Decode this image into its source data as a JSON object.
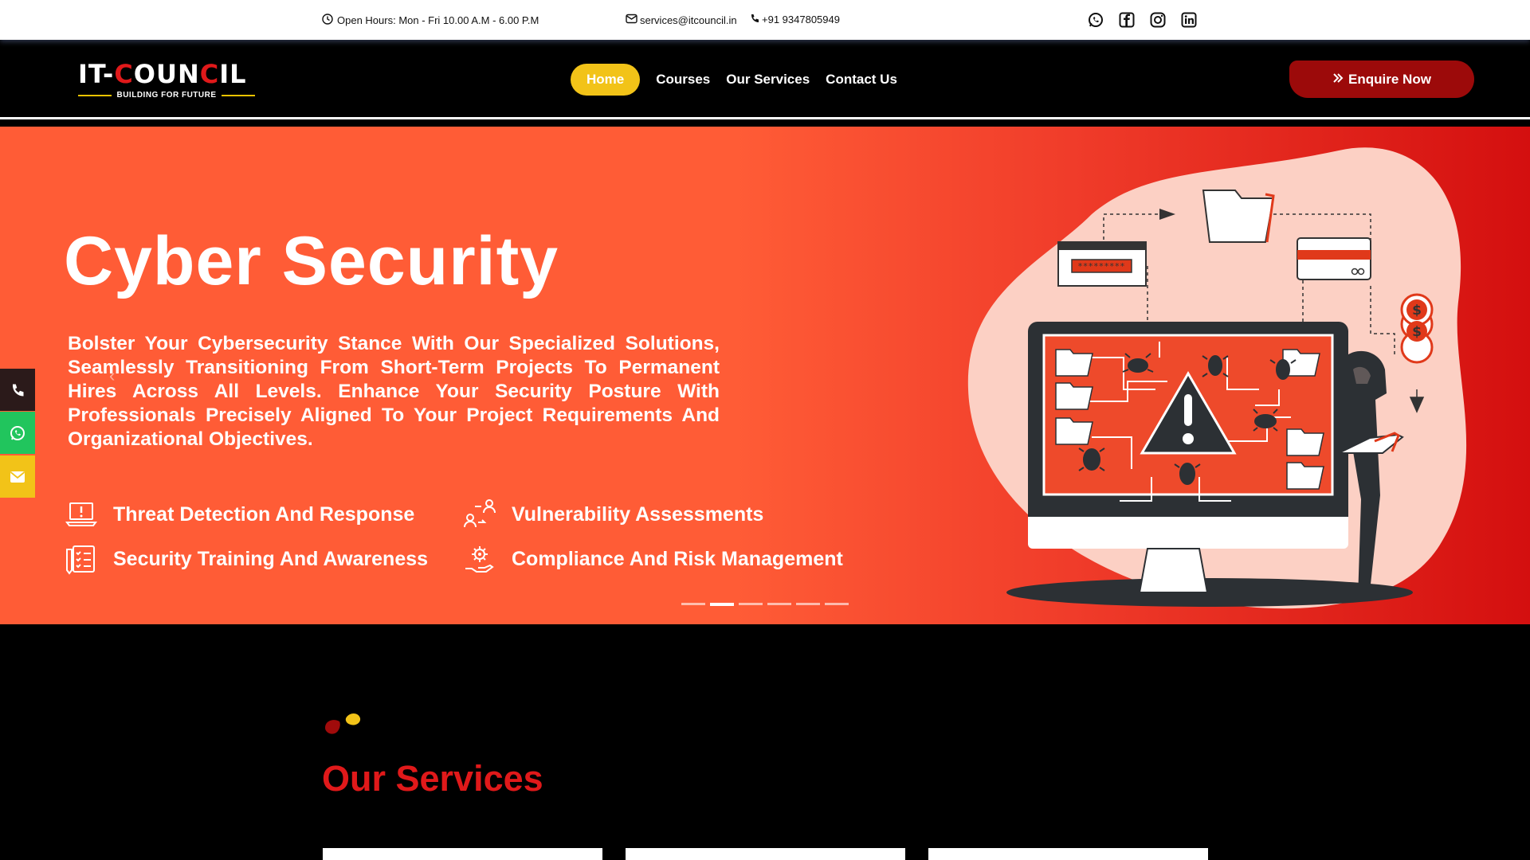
{
  "topbar": {
    "hours": "Open Hours: Mon - Fri 10.00 A.M - 6.00 P.M",
    "email": "services@itcouncil.in",
    "phone": "+91 9347805949",
    "socials": [
      "whatsapp-icon",
      "facebook-icon",
      "instagram-icon",
      "linkedin-icon"
    ]
  },
  "brand": {
    "name_prefix": "IT-",
    "name_c1": "C",
    "name_mid": "OUN",
    "name_c2": "C",
    "name_suffix": "IL",
    "tagline": "BUILDING FOR FUTURE"
  },
  "nav": {
    "items": [
      {
        "label": "Home",
        "active": true
      },
      {
        "label": "Courses"
      },
      {
        "label": "Our Services"
      },
      {
        "label": "Contact Us"
      }
    ],
    "cta": "Enquire Now"
  },
  "hero": {
    "title": "Cyber Security",
    "description": "Bolster Your Cybersecurity Stance With Our Specialized Solutions, Seamlessly Transitioning From Short-Term Projects To Permanent Hires Across All Levels. Enhance Your Security Posture With Professionals Precisely Aligned To Your Project Requirements And Organizational Objectives.",
    "features": [
      "Threat Detection And Response",
      "Vulnerability Assessments",
      "Security Training And Awareness",
      "Compliance And Risk Management"
    ],
    "slides_total": 6,
    "slide_active": 2,
    "password_mask": "*********"
  },
  "services": {
    "heading": "Our Services"
  },
  "colors": {
    "accent_red": "#e0191a",
    "accent_yellow": "#f2c318",
    "hero_orange": "#ff5c36",
    "cta_dark_red": "#9c0a0a"
  }
}
